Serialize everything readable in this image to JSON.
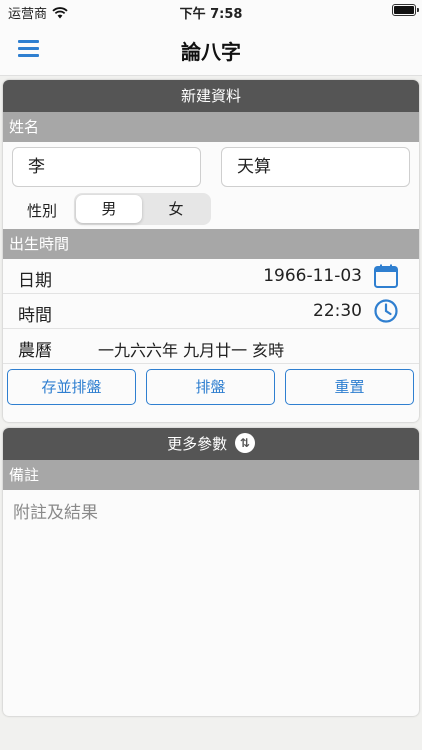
{
  "status": {
    "carrier": "运营商",
    "time": "下午 7:58"
  },
  "nav": {
    "title": "論八字"
  },
  "new_record": {
    "header": "新建資料",
    "name_section": "姓名",
    "surname": "李",
    "given_name": "天算",
    "gender_label": "性別",
    "gender_options": [
      "男",
      "女"
    ],
    "gender_selected": "男",
    "birth_section": "出生時間",
    "date_label": "日期",
    "date_value": "1966-11-03",
    "time_label": "時間",
    "time_value": "22:30",
    "lunar_label": "農曆",
    "lunar_value": "一九六六年 九月廿一 亥時",
    "buttons": {
      "save_plot": "存並排盤",
      "plot": "排盤",
      "reset": "重置"
    }
  },
  "more": {
    "header": "更多參數",
    "notes_section": "備註",
    "notes_placeholder": "附註及結果"
  },
  "colors": {
    "accent": "#2f7fd0",
    "card_header": "#555555",
    "section_header": "#a7a7a7"
  }
}
